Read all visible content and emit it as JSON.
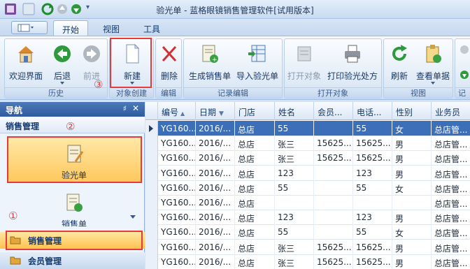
{
  "window": {
    "title": "验光单 - 蓝格眼镜销售管理软件[试用版本]"
  },
  "tabs": [
    {
      "label": "开始",
      "active": true
    },
    {
      "label": "视图",
      "active": false
    },
    {
      "label": "工具",
      "active": false
    }
  ],
  "ribbon": {
    "groups": {
      "history": "历史",
      "create": "对象创建",
      "edit": "编辑",
      "records": "记录编辑",
      "open": "打开对象",
      "view": "视图",
      "more": "记"
    },
    "buttons": {
      "welcome": "欢迎界面",
      "back": "后退",
      "forward": "前进",
      "new": "新建",
      "delete": "删除",
      "gen_sale": "生成销售单",
      "import_opt": "导入验光单",
      "open_obj": "打开对象",
      "print_rx": "打印验光处方",
      "refresh": "刷新",
      "view_form": "查看单据"
    }
  },
  "annotations": {
    "n1": "①",
    "n2": "②",
    "n3": "③"
  },
  "nav": {
    "title": "导航",
    "pin": "♯",
    "close": "✕",
    "section": "销售管理",
    "items": [
      "验光单",
      "销售单"
    ],
    "bars": [
      "销售管理",
      "会员管理"
    ]
  },
  "grid": {
    "columns": [
      "编号",
      "日期",
      "门店",
      "姓名",
      "会员...",
      "电话...",
      "性别",
      "业务员"
    ],
    "rows": [
      [
        "YG160...",
        "2016/...",
        "总店",
        "55",
        "",
        "55",
        "女",
        "总店管..."
      ],
      [
        "YG160...",
        "2016/...",
        "总店",
        "张三",
        "15625...",
        "15625...",
        "男",
        "总店管..."
      ],
      [
        "YG160...",
        "2016/...",
        "总店",
        "张三",
        "15625...",
        "15625...",
        "男",
        "总店管..."
      ],
      [
        "YG160...",
        "2016/...",
        "总店",
        "123",
        "",
        "123",
        "男",
        "总店管..."
      ],
      [
        "YG160...",
        "2016/...",
        "总店",
        "55",
        "",
        "55",
        "女",
        "总店管..."
      ],
      [
        "YG160...",
        "2016/...",
        "总店",
        "",
        "",
        "",
        "",
        "总店管..."
      ],
      [
        "YG160...",
        "2016/...",
        "总店",
        "123",
        "",
        "123",
        "男",
        "总店管..."
      ],
      [
        "YG160...",
        "2016/...",
        "总店",
        "55",
        "",
        "55",
        "女",
        "总店管..."
      ],
      [
        "YG160...",
        "2016/...",
        "总店",
        "张三",
        "15625...",
        "15625...",
        "男",
        "总店管..."
      ],
      [
        "YG160...",
        "2016/...",
        "总店",
        "张三",
        "15625...",
        "15625...",
        "男",
        "总店管..."
      ]
    ]
  },
  "colors": {
    "highlight": "#e83a3a",
    "selected_row": "#3d6fb8",
    "nav_selected": "#ffc85c"
  }
}
